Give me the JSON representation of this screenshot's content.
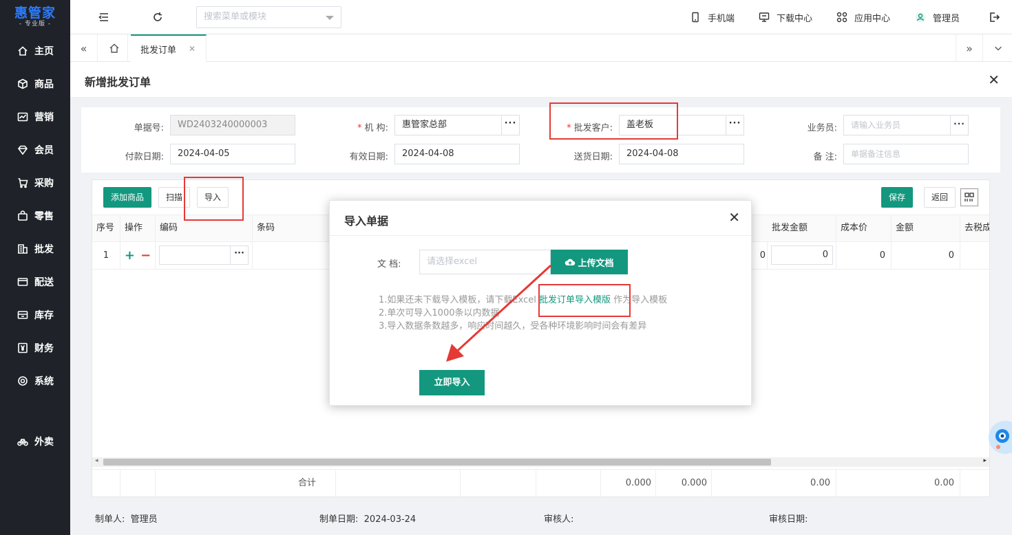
{
  "app": {
    "logo_main": "惠管家",
    "logo_sub": "- 专业版 -"
  },
  "sidebar": {
    "items": [
      {
        "label": "主页",
        "icon": "home-icon"
      },
      {
        "label": "商品",
        "icon": "box-icon"
      },
      {
        "label": "营销",
        "icon": "chart-icon"
      },
      {
        "label": "会员",
        "icon": "diamond-icon"
      },
      {
        "label": "采购",
        "icon": "cart-icon"
      },
      {
        "label": "零售",
        "icon": "bag-icon"
      },
      {
        "label": "批发",
        "icon": "building-icon"
      },
      {
        "label": "配送",
        "icon": "truck-icon"
      },
      {
        "label": "库存",
        "icon": "inventory-icon"
      },
      {
        "label": "财务",
        "icon": "yen-icon"
      },
      {
        "label": "系统",
        "icon": "gear-icon"
      }
    ],
    "extra": {
      "label": "外卖",
      "icon": "bike-icon"
    }
  },
  "header": {
    "search_placeholder": "搜索菜单或模块",
    "mobile": "手机端",
    "download": "下载中心",
    "apps": "应用中心",
    "user": "管理员"
  },
  "tabs": {
    "active": "批发订单"
  },
  "panel": {
    "title": "新增批发订单"
  },
  "form": {
    "doc_no_label": "单据号:",
    "doc_no": "WD2403240000003",
    "org_label": "机 构:",
    "org": "惠管家总部",
    "customer_label": "批发客户:",
    "customer": "盖老板",
    "salesman_label": "业务员:",
    "salesman_placeholder": "请输入业务员",
    "pay_date_label": "付款日期:",
    "pay_date": "2024-04-05",
    "valid_date_label": "有效日期:",
    "valid_date": "2024-04-08",
    "delivery_date_label": "送货日期:",
    "delivery_date": "2024-04-08",
    "remark_label": "备 注:",
    "remark_placeholder": "单据备注信息"
  },
  "toolbar": {
    "add": "添加商品",
    "scan": "扫描",
    "import": "导入",
    "save": "保存",
    "back": "返回"
  },
  "table": {
    "headers": [
      "序号",
      "操作",
      "编码",
      "条码",
      "批发金额",
      "成本价",
      "金额",
      "去税成"
    ],
    "row": {
      "no": "1",
      "v0": "0",
      "v1": "0",
      "v2": "0",
      "v3": "0"
    },
    "footer": {
      "label": "合计",
      "t1": "0.000",
      "t2": "0.000",
      "t3": "0.00",
      "t4": "0.00"
    }
  },
  "meta": {
    "creator_label": "制单人:",
    "creator": "管理员",
    "create_date_label": "制单日期:",
    "create_date": "2024-03-24",
    "auditor_label": "审核人:",
    "audit_date_label": "审核日期:"
  },
  "modal": {
    "title": "导入单据",
    "doc_label": "文 档:",
    "file_placeholder": "请选择excel",
    "upload": "上传文档",
    "tip1_pre": "1.如果还未下载导入模板，请下载Excel ",
    "tip1_link": "批发订单导入模版",
    "tip1_post": " 作为导入模板",
    "tip2": "2.单次可导入1000条以内数据",
    "tip3": "3.导入数据条数越多，响应时间越久，受各种环境影响时间会有差异",
    "import_now": "立即导入"
  },
  "colors": {
    "primary": "#13987f",
    "sidebar": "#1f2329",
    "logo": "#2b7cff",
    "highlight": "#e53935"
  }
}
